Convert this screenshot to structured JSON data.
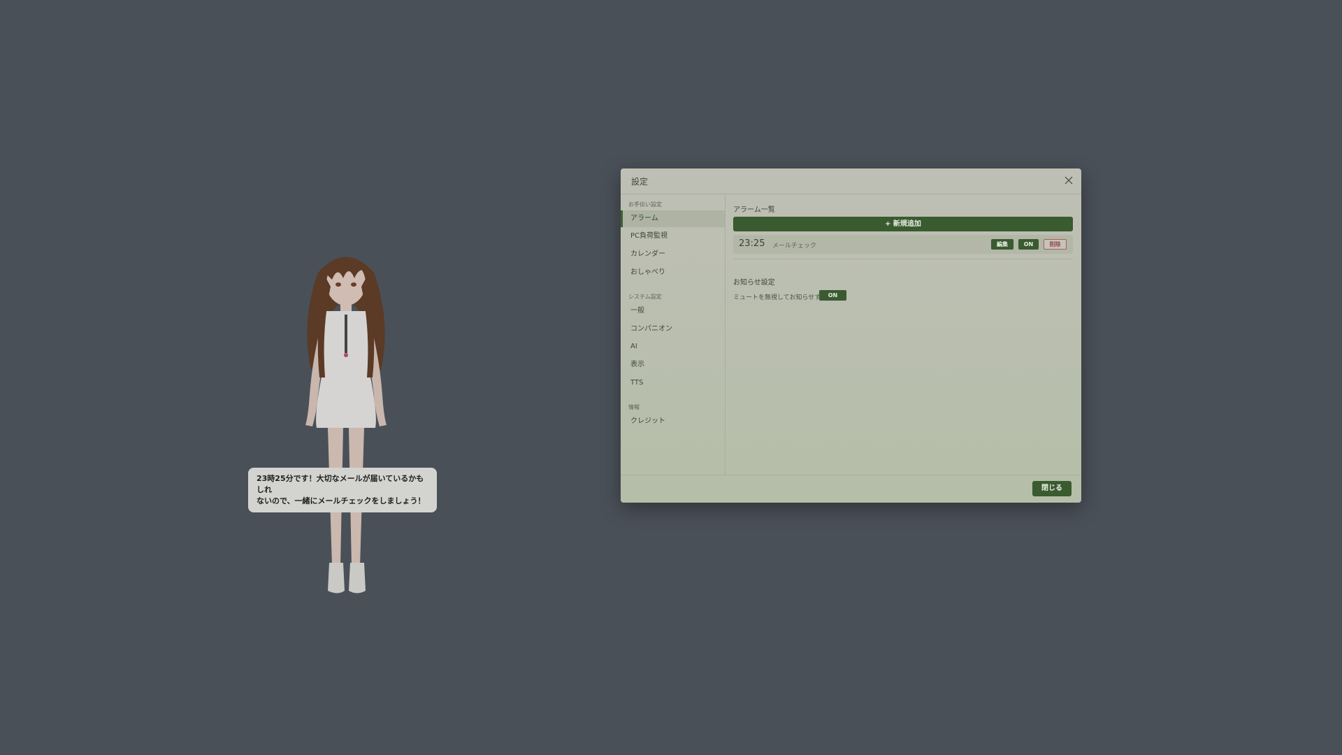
{
  "companion": {
    "speech": "23時25分です！大切なメールが届いているかもしれ\nないので、一緒にメールチェックをしましょう！"
  },
  "dialog": {
    "title": "設定",
    "close_icon": "close-icon",
    "sidebar": {
      "sections": [
        {
          "label": "お手伝い設定",
          "items": [
            {
              "label": "アラーム",
              "active": true
            },
            {
              "label": "PC負荷監視"
            },
            {
              "label": "カレンダー"
            },
            {
              "label": "おしゃべり"
            }
          ]
        },
        {
          "label": "システム設定",
          "items": [
            {
              "label": "一般"
            },
            {
              "label": "コンパニオン"
            },
            {
              "label": "AI"
            },
            {
              "label": "表示"
            },
            {
              "label": "TTS"
            }
          ]
        },
        {
          "label": "情報",
          "items": [
            {
              "label": "クレジット"
            }
          ]
        }
      ]
    },
    "content": {
      "alarm_list_heading": "アラーム一覧",
      "add_button": "+ 新規追加",
      "alarms": [
        {
          "time": "23:25",
          "label": "メールチェック",
          "edit_label": "編集",
          "toggle_label": "ON",
          "delete_label": "削除"
        }
      ],
      "notice_heading": "お知らせ設定",
      "notice_text": "ミュートを無視してお知らせする",
      "notice_toggle": "ON"
    },
    "footer": {
      "close_button": "閉じる"
    }
  },
  "colors": {
    "background": "#4a5058",
    "accent_green": "#3a5a30",
    "delete_red": "#a86060"
  }
}
